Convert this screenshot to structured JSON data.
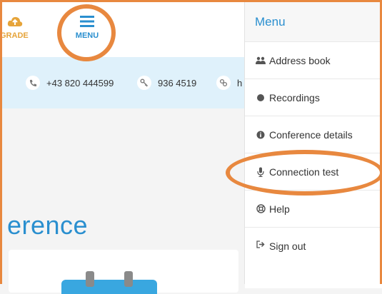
{
  "topbar": {
    "upgrade_label": "GRADE",
    "menu_label": "MENU"
  },
  "infobar": {
    "phone": "+43 820 444599",
    "pin": "936 4519",
    "link": "h"
  },
  "main": {
    "title": "erence"
  },
  "side_menu": {
    "title": "Menu",
    "items": [
      {
        "label": "Address book",
        "icon": "people-icon"
      },
      {
        "label": "Recordings",
        "icon": "record-dot-icon"
      },
      {
        "label": "Conference details",
        "icon": "info-icon"
      },
      {
        "label": "Connection test",
        "icon": "microphone-icon"
      },
      {
        "label": "Help",
        "icon": "lifebuoy-icon"
      },
      {
        "label": "Sign out",
        "icon": "sign-out-icon"
      }
    ]
  },
  "colors": {
    "accent": "#2a8fcf",
    "highlight": "#e8883f",
    "upgrade": "#e6a43a",
    "infobar_bg": "#dff1fb"
  }
}
